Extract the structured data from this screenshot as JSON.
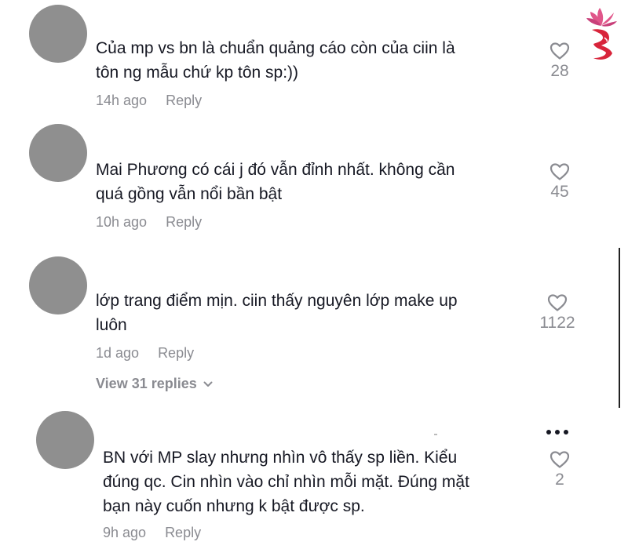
{
  "comments": [
    {
      "text": "Của mp vs bn là chuẩn quảng cáo còn của ciin là\ntôn ng mẫu chứ kp tôn sp:))",
      "time": "14h ago",
      "reply": "Reply",
      "likes": "28"
    },
    {
      "text": "Mai Phương có cái j đó vẫn đỉnh nhất. không cần\nquá gồng vẫn nổi bần bật",
      "time": "10h ago",
      "reply": "Reply",
      "likes": "45"
    },
    {
      "text": "lớp trang điểm mịn. ciin thấy nguyên lớp make up\nluôn",
      "time": "1d ago",
      "reply": "Reply",
      "likes": "1122",
      "view_replies": "View 31 replies"
    },
    {
      "text": "BN với MP slay nhưng nhìn vô thấy sp liền. Kiểu\nđúng qc. Cin nhìn vào chỉ nhìn mỗi mặt. Đúng mặt\nbạn này cuốn nhưng k bật được sp.",
      "time": "9h ago",
      "reply": "Reply",
      "likes": "2"
    }
  ],
  "icons": {
    "like": "heart-outline-icon",
    "more": "more-dots-icon",
    "expand": "chevron-down-icon",
    "logo": "lotus-face-logo"
  },
  "colors": {
    "text": "#161823",
    "secondary": "#8a8b91",
    "avatar": "#8f8f8f",
    "logo_red": "#d8243a",
    "logo_pink": "#e0568a"
  }
}
